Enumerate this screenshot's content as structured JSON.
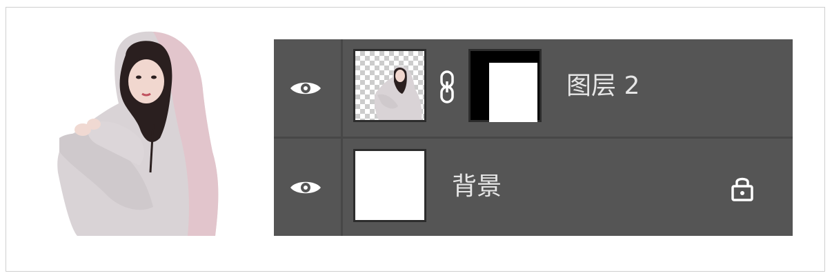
{
  "layers_panel": {
    "layers": [
      {
        "name": "图层 2",
        "visible": true,
        "has_mask": true,
        "mask_linked": true,
        "icons": {
          "visibility": "eye-icon",
          "link": "chain-link-icon"
        }
      },
      {
        "name": "背景",
        "visible": true,
        "locked": true,
        "icons": {
          "visibility": "eye-icon",
          "lock": "lock-icon"
        }
      }
    ]
  },
  "colors": {
    "panel_bg": "#555555",
    "separator": "#474747",
    "text": "#e6e6e6",
    "icon": "#ffffff"
  }
}
